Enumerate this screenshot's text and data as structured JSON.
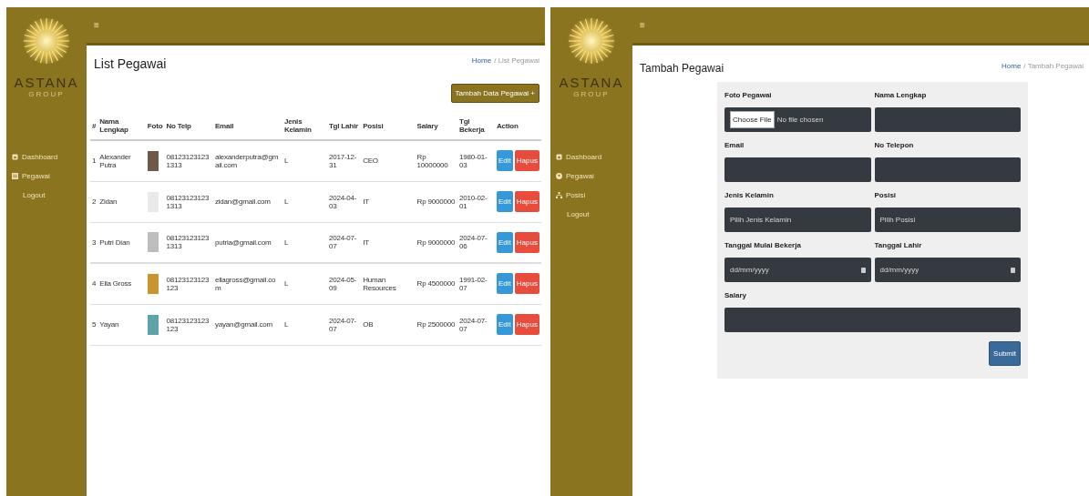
{
  "screens": [
    {
      "kind": "list",
      "brand": "ASTANA",
      "subbrand": "GROUP",
      "menu_icon": "≡",
      "sidebar": {
        "items": [
          {
            "label": "Dashboard",
            "kind": "dashboard"
          },
          {
            "label": "Pegawai",
            "kind": "list"
          },
          {
            "label": "Logout",
            "kind": "plain"
          }
        ]
      },
      "title": "List Pegawai",
      "breadcrumb": {
        "home": "Home",
        "current": "/ List Pegawai"
      },
      "add_button": "Tambah Data Pegawai +",
      "table": {
        "columns": [
          "#",
          "Nama Lengkap",
          "Foto",
          "No Telp",
          "Email",
          "Jenis Kelamin",
          "Tgl Lahir",
          "Posisi",
          "Salary",
          "Tgl Bekerja",
          "Action"
        ],
        "rows": [
          {
            "no": "1",
            "name": "Alexander Putra",
            "phone": "081231231231313",
            "email": "alexanderputra@gmail.com",
            "gender": "L",
            "birth": "2017-12-31",
            "position": "CEO",
            "salary": "Rp 10000000",
            "hired": "1980-01-03",
            "edit": "Edit",
            "delete": "Hapus"
          },
          {
            "no": "2",
            "name": "Zidan",
            "phone": "081231231231313",
            "email": "zidan@gmail.com",
            "gender": "L",
            "birth": "2024-04-03",
            "position": "IT",
            "salary": "Rp 9000000",
            "hired": "2010-02-01",
            "edit": "Edit",
            "delete": "Hapus"
          },
          {
            "no": "3",
            "name": "Putri Dian",
            "phone": "081231231231313",
            "email": "putria@gmail.com",
            "gender": "L",
            "birth": "2024-07-07",
            "position": "IT",
            "salary": "Rp 9000000",
            "hired": "2024-07-06",
            "edit": "Edit",
            "delete": "Hapus"
          },
          {
            "no": "4",
            "name": "Ella Gross",
            "phone": "08123123123123",
            "email": "ellagross@gmail.com",
            "gender": "L",
            "birth": "2024-05-09",
            "position": "Human Resources",
            "salary": "Rp 4500000",
            "hired": "1991-02-07",
            "edit": "Edit",
            "delete": "Hapus"
          },
          {
            "no": "5",
            "name": "Yayan",
            "phone": "08123123123123",
            "email": "yayan@gmail.com",
            "gender": "L",
            "birth": "2024-07-07",
            "position": "OB",
            "salary": "Rp 2500000",
            "hired": "2024-07-07",
            "edit": "Edit",
            "delete": "Hapus"
          }
        ]
      }
    },
    {
      "kind": "form",
      "brand": "ASTANA",
      "subbrand": "GROUP",
      "menu_icon": "≡",
      "sidebar": {
        "items": [
          {
            "label": "Dashboard",
            "kind": "dashboard"
          },
          {
            "label": "Pegawai",
            "kind": "person"
          },
          {
            "label": "Posisi",
            "kind": "tree"
          },
          {
            "label": "Logout",
            "kind": "plain"
          }
        ]
      },
      "title": "Tambah Pegawai",
      "breadcrumb": {
        "home": "Home",
        "current": "/ Tambah Pegawai"
      },
      "form": {
        "fields": [
          {
            "label": "Foto Pegawai",
            "kind": "file",
            "button": "Choose File",
            "status": "No file chosen"
          },
          {
            "label": "Nama Lengkap",
            "kind": "text"
          },
          {
            "label": "Email",
            "kind": "text"
          },
          {
            "label": "No Telepon",
            "kind": "text"
          },
          {
            "label": "Jenis Kelamin",
            "kind": "select",
            "value": "Pilih Jenis Kelamin"
          },
          {
            "label": "Posisi",
            "kind": "select",
            "value": "Pilih Posisi"
          },
          {
            "label": "Tanggal Mulai Bekerja",
            "kind": "date",
            "placeholder": "dd/mm/yyyy"
          },
          {
            "label": "Tanggal Lahir",
            "kind": "date",
            "placeholder": "dd/mm/yyyy"
          },
          {
            "label": "Salary",
            "kind": "text"
          }
        ],
        "submit": "Submit"
      }
    }
  ]
}
